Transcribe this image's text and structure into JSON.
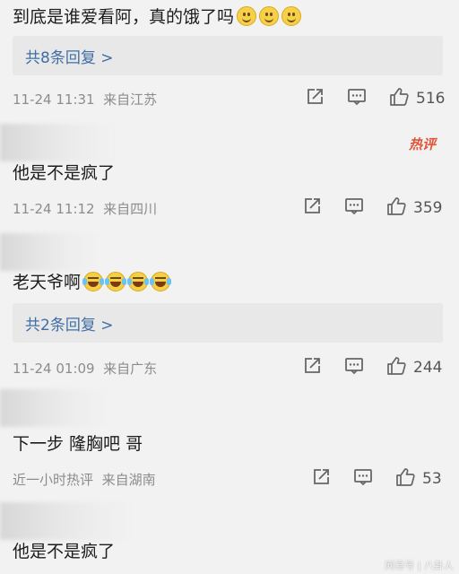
{
  "comments": [
    {
      "text": "到底是谁爱看阿，真的饿了吗",
      "emojis": [
        "smile",
        "smile",
        "smile"
      ],
      "reply_link": "共8条回复 >",
      "time": "11-24 11:31",
      "location": "来自江苏",
      "likes": "516"
    },
    {
      "hot_badge": "热评",
      "text": "他是不是疯了",
      "time": "11-24 11:12",
      "location": "来自四川",
      "likes": "359"
    },
    {
      "text": "老天爷啊",
      "emojis": [
        "laugh",
        "laugh",
        "laugh",
        "laugh"
      ],
      "reply_link": "共2条回复 >",
      "time": "11-24 01:09",
      "location": "来自广东",
      "likes": "244"
    },
    {
      "text": "下一步 隆胸吧 哥",
      "time": "近一小时热评",
      "location": "来自湖南",
      "likes": "53"
    },
    {
      "text": "他是不是疯了"
    }
  ],
  "icons": {
    "share": "share-icon",
    "comment": "comment-icon",
    "like": "thumbs-up-icon"
  },
  "colors": {
    "link": "#3f6fa6",
    "hot": "#e0553a",
    "meta": "#8c8c8c"
  },
  "watermark": "网易号 | 八卦人"
}
